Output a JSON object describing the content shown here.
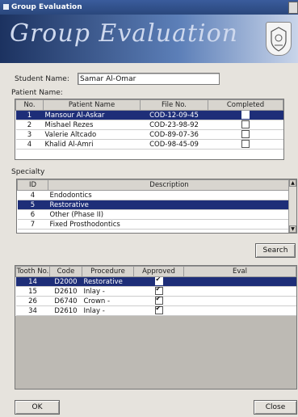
{
  "window": {
    "title": "Group Evaluation"
  },
  "banner": {
    "title": "Group Evaluation"
  },
  "student": {
    "label": "Student Name:",
    "value": "Samar Al-Omar"
  },
  "patients": {
    "label": "Patient Name:",
    "columns": [
      "No.",
      "Patient Name",
      "File No.",
      "Completed"
    ],
    "rows": [
      {
        "no": "1",
        "name": "Mansour Al-Askar",
        "file": "COD-12-09-45",
        "completed": false,
        "selected": true
      },
      {
        "no": "2",
        "name": "Mishael Rezes",
        "file": "COD-23-98-92",
        "completed": false,
        "selected": false
      },
      {
        "no": "3",
        "name": "Valerie Altcado",
        "file": "COD-89-07-36",
        "completed": false,
        "selected": false
      },
      {
        "no": "4",
        "name": "Khalid Al-Amri",
        "file": "COD-98-45-09",
        "completed": false,
        "selected": false
      }
    ]
  },
  "specialty": {
    "label": "Specialty",
    "columns": [
      "ID",
      "Description"
    ],
    "rows": [
      {
        "id": "4",
        "desc": "Endodontics",
        "selected": false
      },
      {
        "id": "5",
        "desc": "Restorative",
        "selected": true
      },
      {
        "id": "6",
        "desc": "Other (Phase II)",
        "selected": false
      },
      {
        "id": "7",
        "desc": "Fixed Prosthodontics",
        "selected": false
      }
    ]
  },
  "search_button": "Search",
  "procedures": {
    "columns": [
      "Tooth No.",
      "Code",
      "Procedure",
      "Approved",
      "Eval"
    ],
    "rows": [
      {
        "tooth": "14",
        "code": "D2000",
        "proc": "Restorative",
        "approved": true,
        "eval": "",
        "selected": true
      },
      {
        "tooth": "15",
        "code": "D2610",
        "proc": "Inlay -",
        "approved": true,
        "eval": "",
        "selected": false
      },
      {
        "tooth": "26",
        "code": "D6740",
        "proc": "Crown -",
        "approved": true,
        "eval": "",
        "selected": false
      },
      {
        "tooth": "34",
        "code": "D2610",
        "proc": "Inlay -",
        "approved": true,
        "eval": "",
        "selected": false
      }
    ]
  },
  "ok_button": "OK",
  "close_button": "Close"
}
